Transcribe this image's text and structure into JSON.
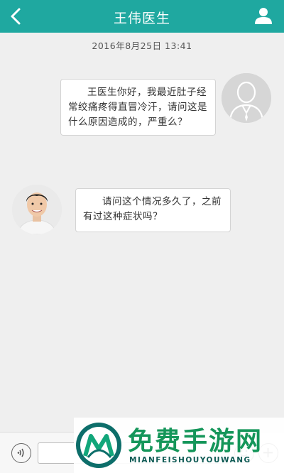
{
  "header": {
    "title": "王伟医生",
    "back_icon": "chevron-left-icon",
    "profile_icon": "person-icon",
    "color": "#1fa8a0"
  },
  "chat": {
    "timestamp": "2016年8月25日 13:41",
    "messages": [
      {
        "sender": "patient",
        "text": "王医生你好，我最近肚子经常绞痛疼得直冒冷汗，请问这是什么原因造成的，严重么？"
      },
      {
        "sender": "doctor",
        "text": "请问这个情况多久了，之前有过这种症状吗？"
      }
    ]
  },
  "input_bar": {
    "voice_icon": "voice-icon",
    "emoji_icon": "emoji-icon",
    "add_icon": "plus-icon",
    "input_value": ""
  },
  "watermark": {
    "title": "免费手游网",
    "subtitle": "MIANFEISHOUYOUWANG"
  }
}
